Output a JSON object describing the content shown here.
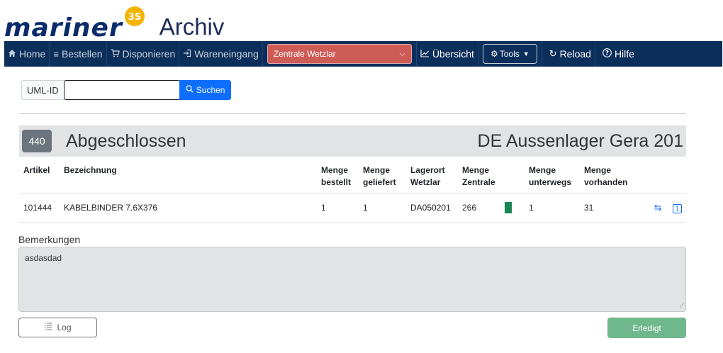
{
  "header": {
    "logo_text": "mariner",
    "logo_badge": "3S",
    "title": "Archiv"
  },
  "nav": {
    "home": "Home",
    "bestellen": "Bestellen",
    "disponieren": "Disponieren",
    "wareneingang": "Wareneingang",
    "location_select": "Zentrale Wetzlar",
    "uebersicht": "Übersicht",
    "tools": "Tools",
    "reload": "Reload",
    "hilfe": "Hilfe"
  },
  "search": {
    "label": "UML-ID",
    "value": "",
    "button": "Suchen"
  },
  "status": {
    "count": "440",
    "title": "Abgeschlossen",
    "location": "DE Aussenlager Gera 201"
  },
  "table": {
    "headers": {
      "artikel": "Artikel",
      "bezeichnung": "Bezeichnung",
      "menge_bestellt_1": "Menge",
      "menge_bestellt_2": "bestellt",
      "menge_geliefert_1": "Menge",
      "menge_geliefert_2": "geliefert",
      "lagerort_1": "Lagerort",
      "lagerort_2": "Wetzlar",
      "menge_zentrale_1": "Menge",
      "menge_zentrale_2": "Zentrale",
      "menge_unterwegs_1": "Menge",
      "menge_unterwegs_2": "unterwegs",
      "menge_vorhanden_1": "Menge",
      "menge_vorhanden_2": "vorhanden"
    },
    "rows": [
      {
        "artikel": "101444",
        "bezeichnung": "KABELBINDER 7.6X376",
        "bestellt": "1",
        "geliefert": "1",
        "lagerort": "DA050201",
        "zentrale": "266",
        "unterwegs": "1",
        "vorhanden": "31",
        "box_label": "1"
      }
    ]
  },
  "remarks": {
    "label": "Bemerkungen",
    "text": "asdasdad"
  },
  "buttons": {
    "log": "Log",
    "done": "Erledigt"
  },
  "colors": {
    "navbar": "#0b2e5b",
    "location_select": "#cd5c57",
    "primary": "#0d6efd",
    "badge": "#6c757d",
    "stock_ok": "#198754",
    "done": "#6fb88c"
  }
}
